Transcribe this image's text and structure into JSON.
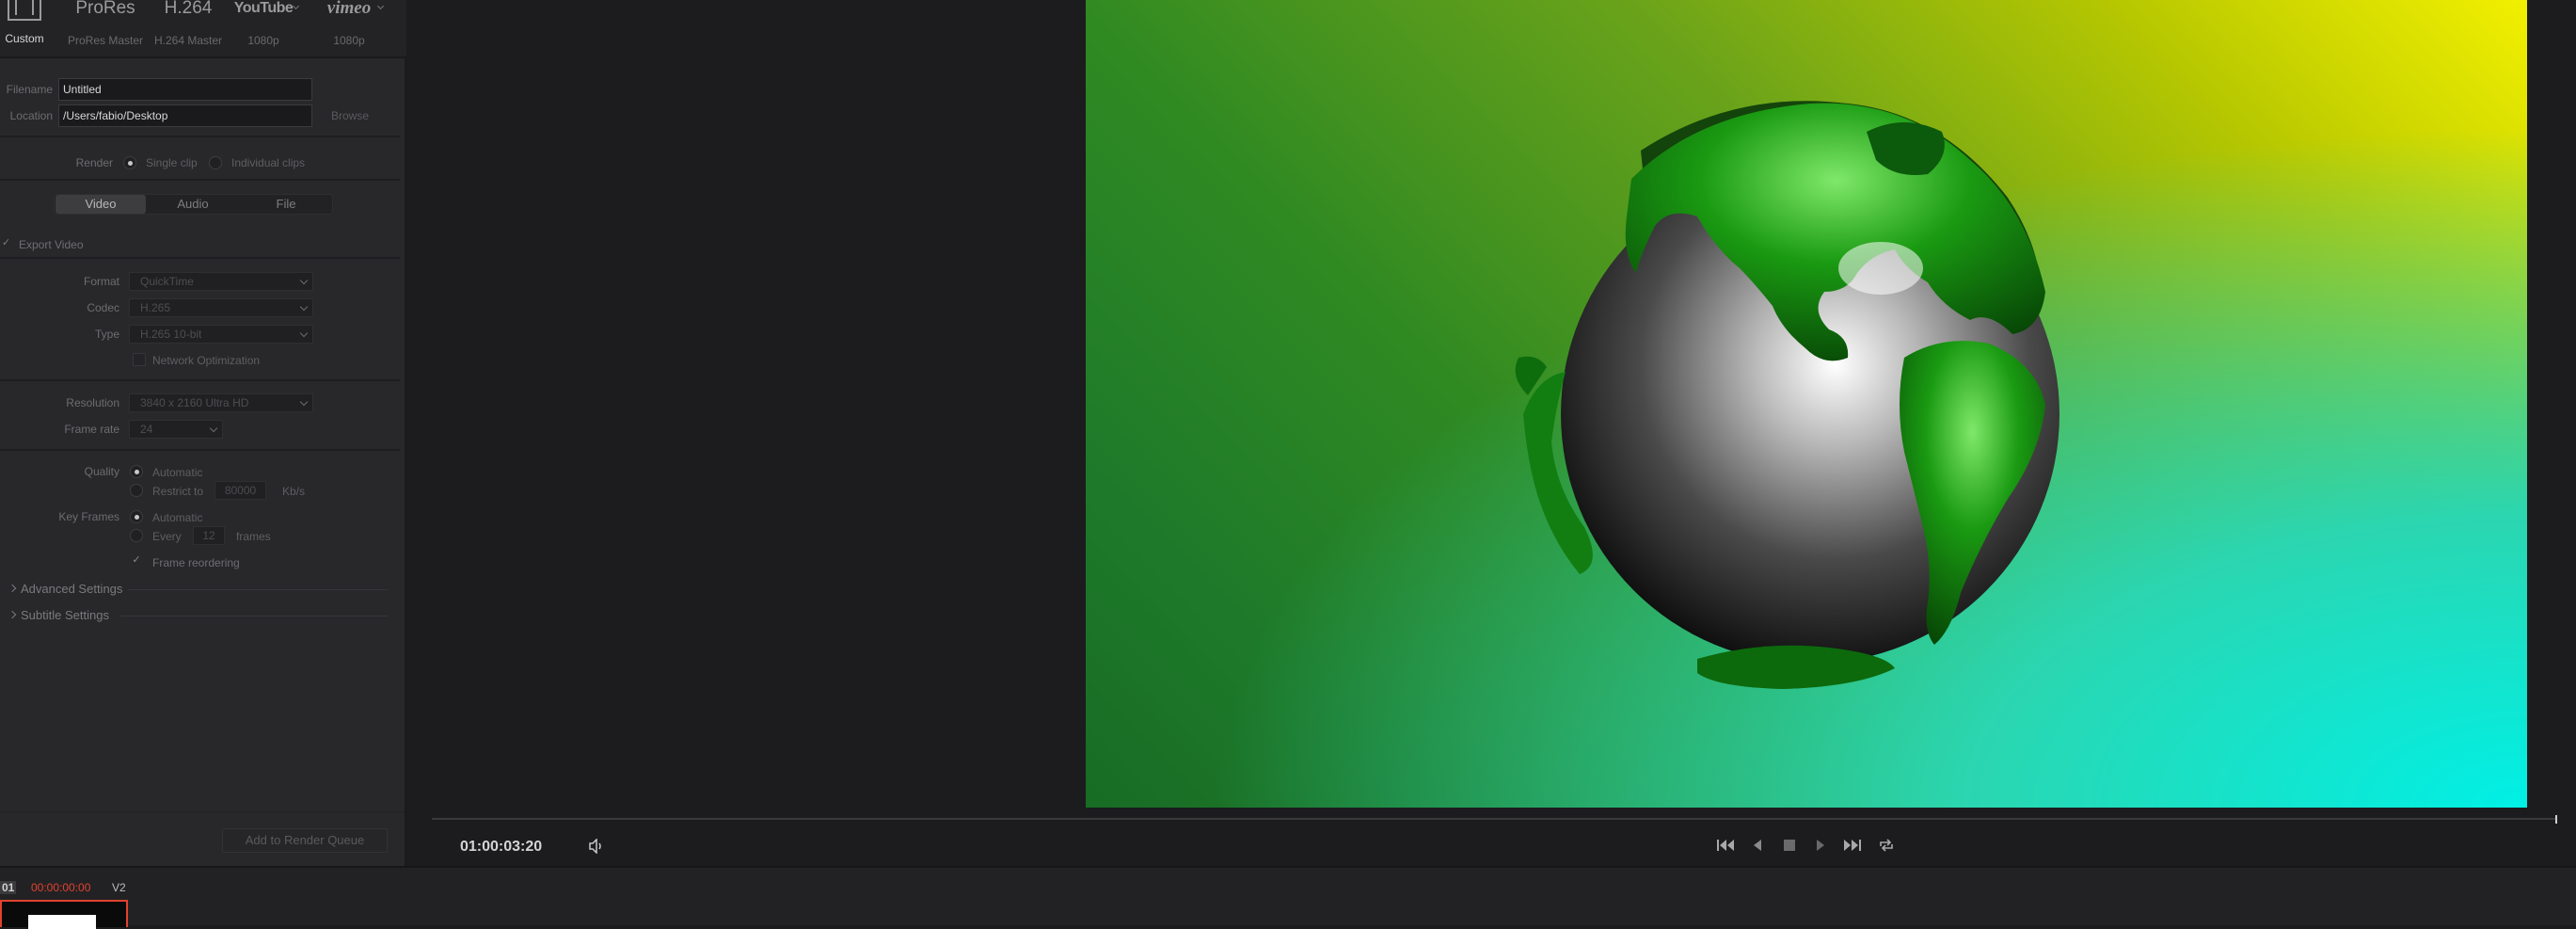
{
  "presets": [
    {
      "title": "",
      "subtitle": "Custom",
      "icon": "film-icon"
    },
    {
      "title": "ProRes",
      "subtitle": "ProRes Master"
    },
    {
      "title": "H.264",
      "subtitle": "H.264 Master"
    },
    {
      "title": "YouTube",
      "subtitle": "1080p"
    },
    {
      "title": "vimeo",
      "subtitle": "1080p"
    }
  ],
  "file": {
    "filename_label": "Filename",
    "filename_value": "Untitled",
    "location_label": "Location",
    "location_value": "/Users/fabio/Desktop",
    "browse_label": "Browse"
  },
  "render": {
    "label": "Render",
    "single_clip": "Single clip",
    "individual_clips": "Individual clips"
  },
  "tabs": [
    "Video",
    "Audio",
    "File"
  ],
  "export_video_label": "Export Video",
  "video": {
    "format_label": "Format",
    "format_value": "QuickTime",
    "codec_label": "Codec",
    "codec_value": "H.265",
    "type_label": "Type",
    "type_value": "H.265 10-bit",
    "network_opt_label": "Network Optimization",
    "resolution_label": "Resolution",
    "resolution_value": "3840 x 2160 Ultra HD",
    "framerate_label": "Frame rate",
    "framerate_value": "24",
    "quality_label": "Quality",
    "quality_auto": "Automatic",
    "quality_restrict": "Restrict to",
    "quality_restrict_value": "80000",
    "quality_unit": "Kb/s",
    "keyframes_label": "Key Frames",
    "keyframes_auto": "Automatic",
    "keyframes_every": "Every",
    "keyframes_every_value": "12",
    "keyframes_unit": "frames",
    "frame_reordering_label": "Frame reordering",
    "advanced_settings": "Advanced Settings",
    "subtitle_settings": "Subtitle Settings"
  },
  "add_to_render_queue": "Add to Render Queue",
  "viewer": {
    "timecode": "01:00:03:20",
    "playhead_fraction": 1.0
  },
  "timeline": {
    "clip_index": "01",
    "clip_timecode": "00:00:00:00",
    "track": "V2"
  },
  "colors": {
    "accent_red": "#e0422e",
    "panel_bg": "#28282b"
  }
}
